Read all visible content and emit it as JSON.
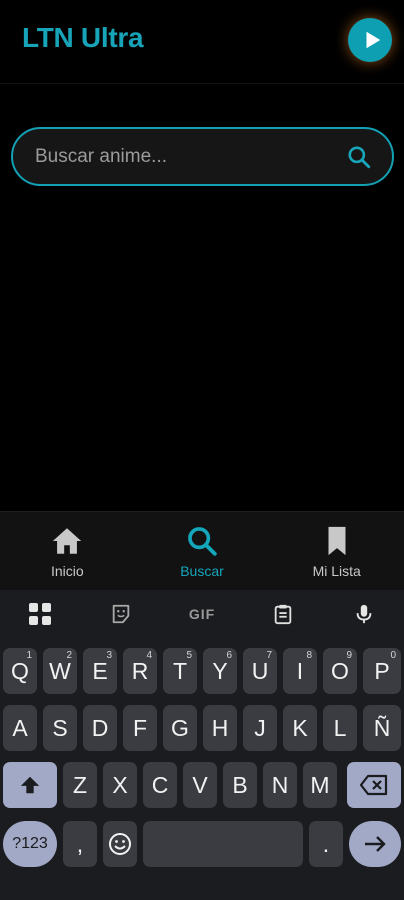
{
  "header": {
    "title": "LTN Ultra",
    "play_icon": "play-icon",
    "accent": "#0e9fb3"
  },
  "search": {
    "placeholder": "Buscar anime...",
    "value": "",
    "icon": "search-icon"
  },
  "nav": {
    "items": [
      {
        "label": "Inicio",
        "icon": "home-icon",
        "active": false
      },
      {
        "label": "Buscar",
        "icon": "search-icon",
        "active": true
      },
      {
        "label": "Mi Lista",
        "icon": "bookmark-icon",
        "active": false
      }
    ],
    "active_color": "#14a6ba"
  },
  "keyboard": {
    "toolbar": {
      "gif_label": "GIF"
    },
    "row1": [
      {
        "key": "Q",
        "hint": "1"
      },
      {
        "key": "W",
        "hint": "2"
      },
      {
        "key": "E",
        "hint": "3"
      },
      {
        "key": "R",
        "hint": "4"
      },
      {
        "key": "T",
        "hint": "5"
      },
      {
        "key": "Y",
        "hint": "6"
      },
      {
        "key": "U",
        "hint": "7"
      },
      {
        "key": "I",
        "hint": "8"
      },
      {
        "key": "O",
        "hint": "9"
      },
      {
        "key": "P",
        "hint": "0"
      }
    ],
    "row2": [
      "A",
      "S",
      "D",
      "F",
      "G",
      "H",
      "J",
      "K",
      "L",
      "Ñ"
    ],
    "row3": [
      "Z",
      "X",
      "C",
      "V",
      "B",
      "N",
      "M"
    ],
    "row4": {
      "symbols": "?123",
      "comma": ",",
      "period": "."
    }
  }
}
